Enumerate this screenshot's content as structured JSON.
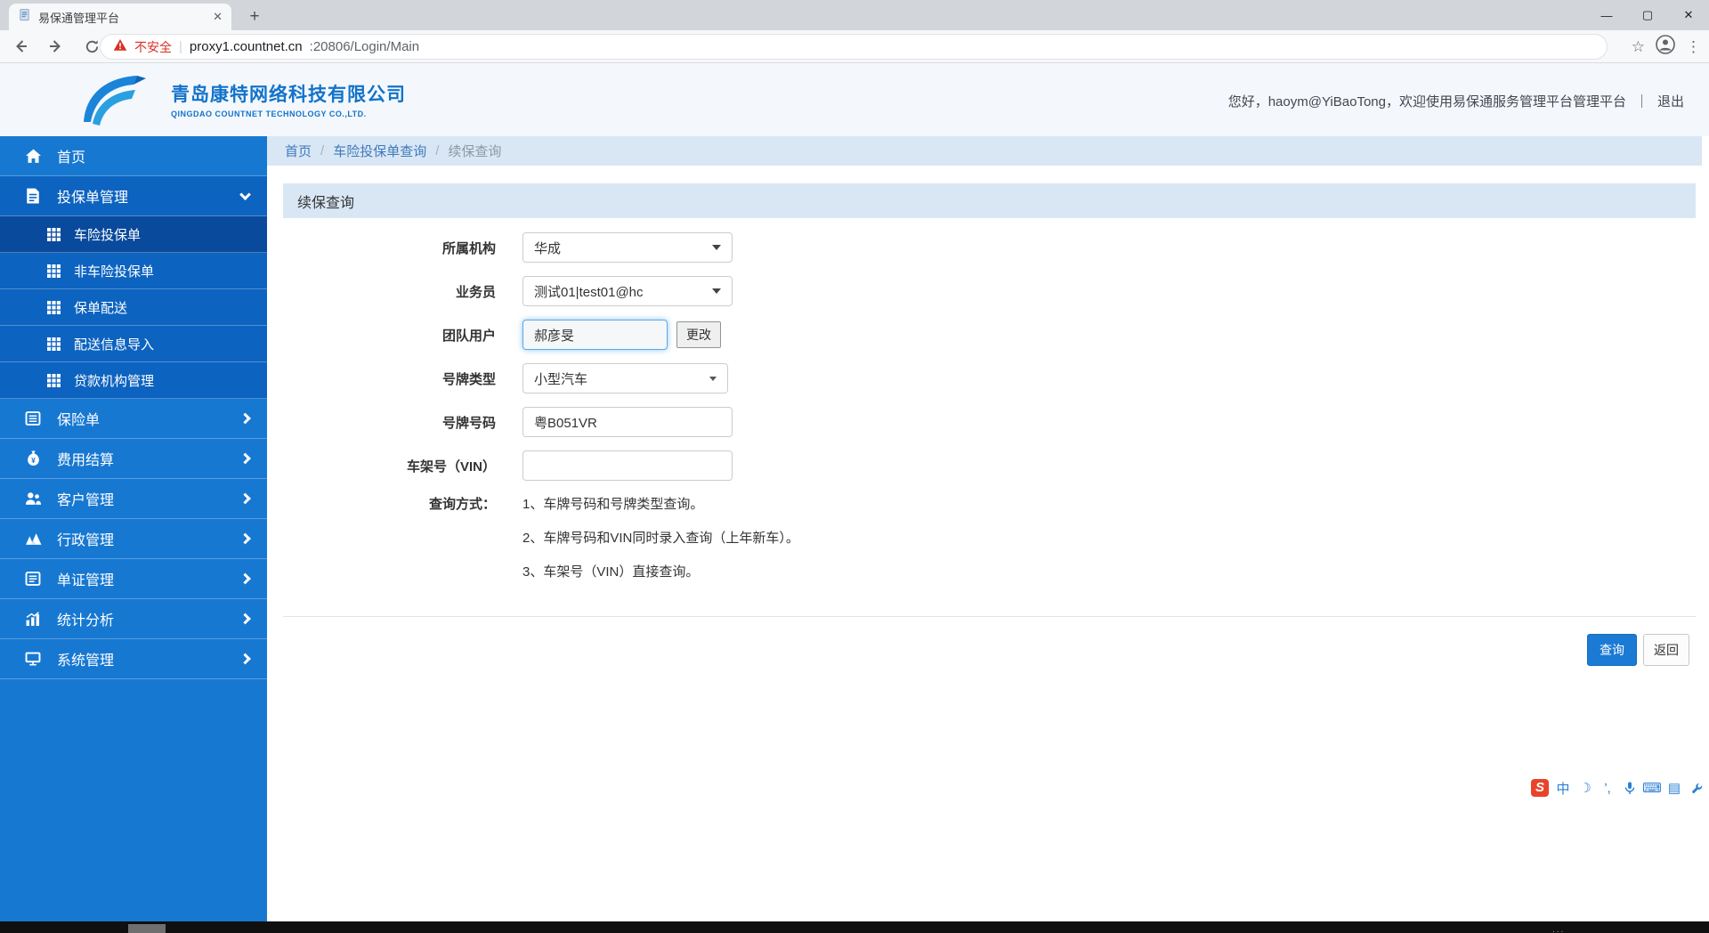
{
  "browser": {
    "tab": {
      "title": "易保通管理平台",
      "close_glyph": "✕"
    },
    "new_tab_glyph": "+",
    "window_controls": {
      "minimize": "—",
      "maximize": "▢",
      "close": "✕"
    },
    "address": {
      "security_label": "不安全",
      "separator": "|",
      "host": "proxy1.countnet.cn",
      "path": ":20806/Login/Main"
    },
    "menu_glyph": "⋮",
    "star_glyph": "☆"
  },
  "header": {
    "company_cn": "青岛康特网络科技有限公司",
    "company_en": "QINGDAO COUNTNET TECHNOLOGY CO.,LTD.",
    "greeting": "您好，haoym@YiBaoTong，欢迎使用易保通服务管理平台管理平台",
    "divider": "｜",
    "logout": "退出"
  },
  "sidebar": {
    "items": [
      {
        "label": "首页"
      },
      {
        "label": "投保单管理"
      },
      {
        "label": "车险投保单"
      },
      {
        "label": "非车险投保单"
      },
      {
        "label": "保单配送"
      },
      {
        "label": "配送信息导入"
      },
      {
        "label": "贷款机构管理"
      },
      {
        "label": "保险单"
      },
      {
        "label": "费用结算"
      },
      {
        "label": "客户管理"
      },
      {
        "label": "行政管理"
      },
      {
        "label": "单证管理"
      },
      {
        "label": "统计分析"
      },
      {
        "label": "系统管理"
      }
    ]
  },
  "breadcrumb": {
    "items": [
      "首页",
      "车险投保单查询",
      "续保查询"
    ],
    "separator": "/"
  },
  "page": {
    "title": "续保查询",
    "form": {
      "fields": [
        {
          "label": "所属机构",
          "value": "华成"
        },
        {
          "label": "业务员",
          "value": "测试01|test01@hc"
        },
        {
          "label": "团队用户",
          "value": "郝彦旻",
          "action": "更改"
        },
        {
          "label": "号牌类型",
          "value": "小型汽车"
        },
        {
          "label": "号牌号码",
          "value": "粤B051VR"
        },
        {
          "label": "车架号（VIN）",
          "value": ""
        }
      ],
      "query_methods": {
        "label": "查询方式：",
        "lines": [
          "1、车牌号码和号牌类型查询。",
          "2、车牌号码和VIN同时录入查询（上年新车）。",
          "3、车架号（VIN）直接查询。"
        ]
      }
    },
    "actions": {
      "query": "查询",
      "back": "返回"
    }
  },
  "ime": {
    "logo_letter": "S",
    "mode_glyph": "中",
    "moon_glyph": "☽",
    "punct_glyph": "’,",
    "keyboard_glyph": "⌨",
    "clipboard_glyph": "▤"
  },
  "colors": {
    "sidebar_blue": "#1778d2",
    "sidebar_group": "#0d63c0",
    "sidebar_selected": "#0a4a9c",
    "accent": "#1a7ad4",
    "bar_light_blue": "#d9e7f5",
    "danger_red": "#d93025",
    "brand_blue": "#1373c9"
  }
}
